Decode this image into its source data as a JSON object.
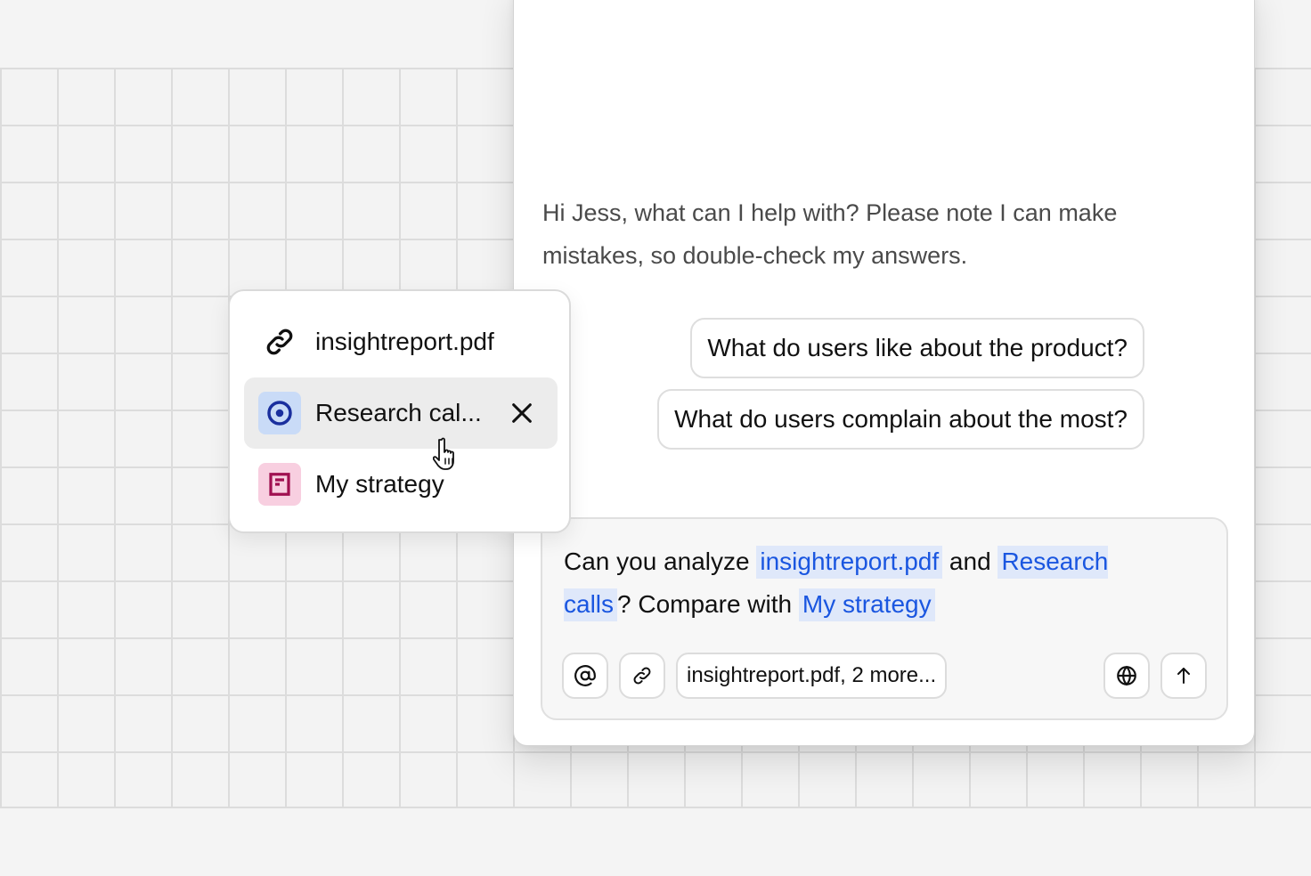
{
  "chat": {
    "greeting": "Hi Jess, what can I help with? Please note I can make mistakes, so double-check my answers.",
    "suggestions": [
      "What do users like about the product?",
      "What do users complain about the most?"
    ]
  },
  "composer": {
    "prompt_parts": {
      "t1": "Can you analyze ",
      "m1": "insightreport.pdf",
      "t2": " and ",
      "m2": "Research calls",
      "t3": "? Compare with ",
      "m3": "My strategy"
    },
    "attachments_label": "insightreport.pdf, 2 more...",
    "icons": {
      "mention": "at-icon",
      "attach": "paperclip-icon",
      "web": "globe-icon",
      "send": "arrow-up-icon"
    }
  },
  "popup": {
    "items": [
      {
        "label": "insightreport.pdf",
        "icon": "paperclip-icon"
      },
      {
        "label": "Research cal...",
        "icon": "target-circle-icon",
        "icon_bg": "#c9dbf7",
        "icon_color": "#1a2f9e",
        "hovered": true
      },
      {
        "label": "My strategy",
        "icon": "document-icon",
        "icon_bg": "#f8cfe0",
        "icon_color": "#a01050"
      }
    ],
    "remove_icon": "close-icon"
  },
  "colors": {
    "mention_text": "#1a56e0",
    "mention_bg": "#dfe8fa"
  }
}
